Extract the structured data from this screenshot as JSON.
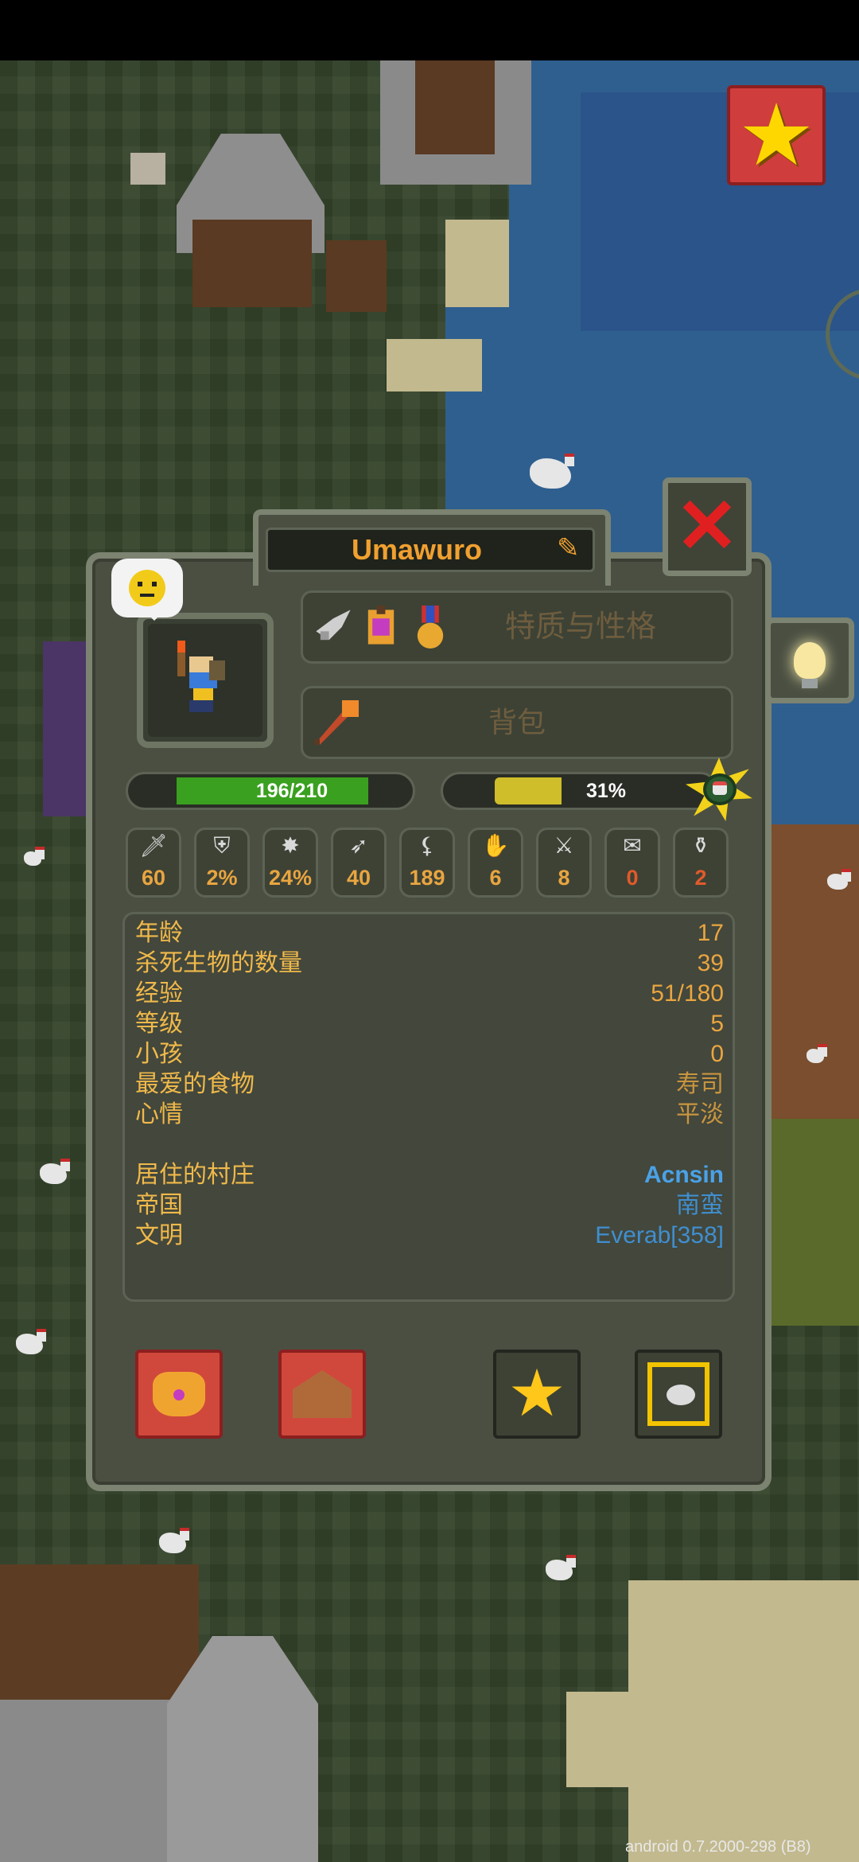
{
  "window": {
    "version_text": "android 0.7.2000-298 (B8)"
  },
  "unit": {
    "name": "Umawuro",
    "traits_label": "特质与性格",
    "inventory_label": "背包",
    "mood_icon": "neutral-face-icon"
  },
  "bars": {
    "health_text": "196/210",
    "health_fraction": 0.933,
    "hunger_text": "31%",
    "hunger_fraction": 0.31,
    "favorite_food_icon": "sushi-icon"
  },
  "stats": [
    {
      "icon": "damage-sword-icon",
      "value": "60",
      "color": "#e9a540"
    },
    {
      "icon": "armor-shield-icon",
      "value": "2%",
      "color": "#e9a540"
    },
    {
      "icon": "critical-star-icon",
      "value": "24%",
      "color": "#e9a540"
    },
    {
      "icon": "speed-wing-icon",
      "value": "40",
      "color": "#e9a540"
    },
    {
      "icon": "attack-speed-scythe-icon",
      "value": "189",
      "color": "#e9a540"
    },
    {
      "icon": "diplomacy-handshake-icon",
      "value": "6",
      "color": "#e9a540"
    },
    {
      "icon": "warfare-swords-icon",
      "value": "8",
      "color": "#e9a540"
    },
    {
      "icon": "stewardship-scroll-icon",
      "value": "0",
      "color": "#e25a2a"
    },
    {
      "icon": "intelligence-potion-icon",
      "value": "2",
      "color": "#e25a2a"
    }
  ],
  "info": [
    {
      "label": "年龄",
      "value": "17"
    },
    {
      "label": "杀死生物的数量",
      "value": "39"
    },
    {
      "label": "经验",
      "value": "51/180"
    },
    {
      "label": "等级",
      "value": "5"
    },
    {
      "label": "小孩",
      "value": "0"
    },
    {
      "label": "最爱的食物",
      "value": "寿司"
    },
    {
      "label": "心情",
      "value": "平淡"
    },
    {
      "label": "居住的村庄",
      "value": "Acnsin"
    },
    {
      "label": "帝国",
      "value": "南蛮"
    },
    {
      "label": "文明",
      "value": "Everab[358]"
    }
  ],
  "colors": {
    "accent_orange": "#f0a030",
    "link_blue": "#4aa2e8",
    "close_red": "#e02020"
  }
}
